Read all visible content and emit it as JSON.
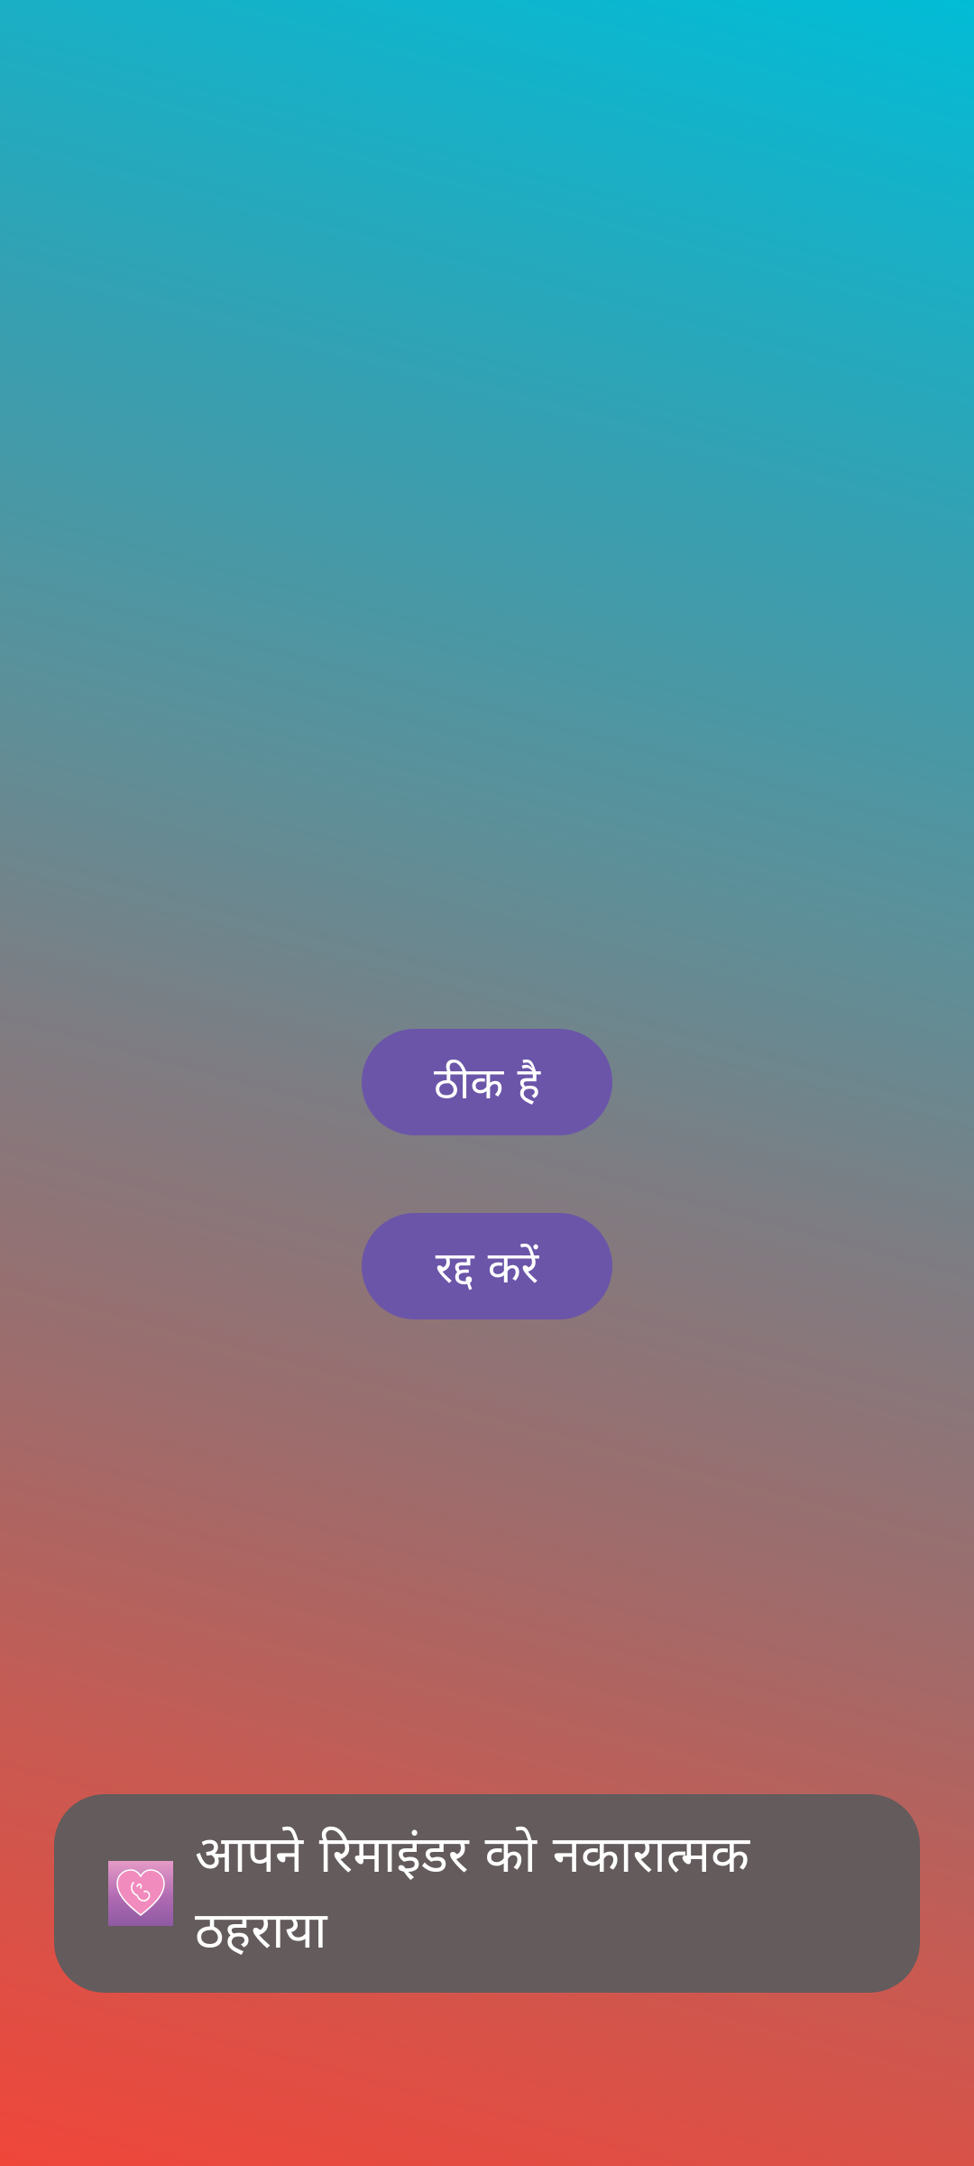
{
  "dialog": {
    "ok_label": "ठीक है",
    "cancel_label": "रद्द करें"
  },
  "toast": {
    "icon": "pregnancy-heart-app-icon",
    "message": "आपने रिमाइंडर को नकारात्मक ठहराया"
  },
  "colors": {
    "button": "#6b55a8",
    "toast_background": "#635b5c",
    "gradient_top": "#02bcd6",
    "gradient_bottom": "#f0463a"
  }
}
